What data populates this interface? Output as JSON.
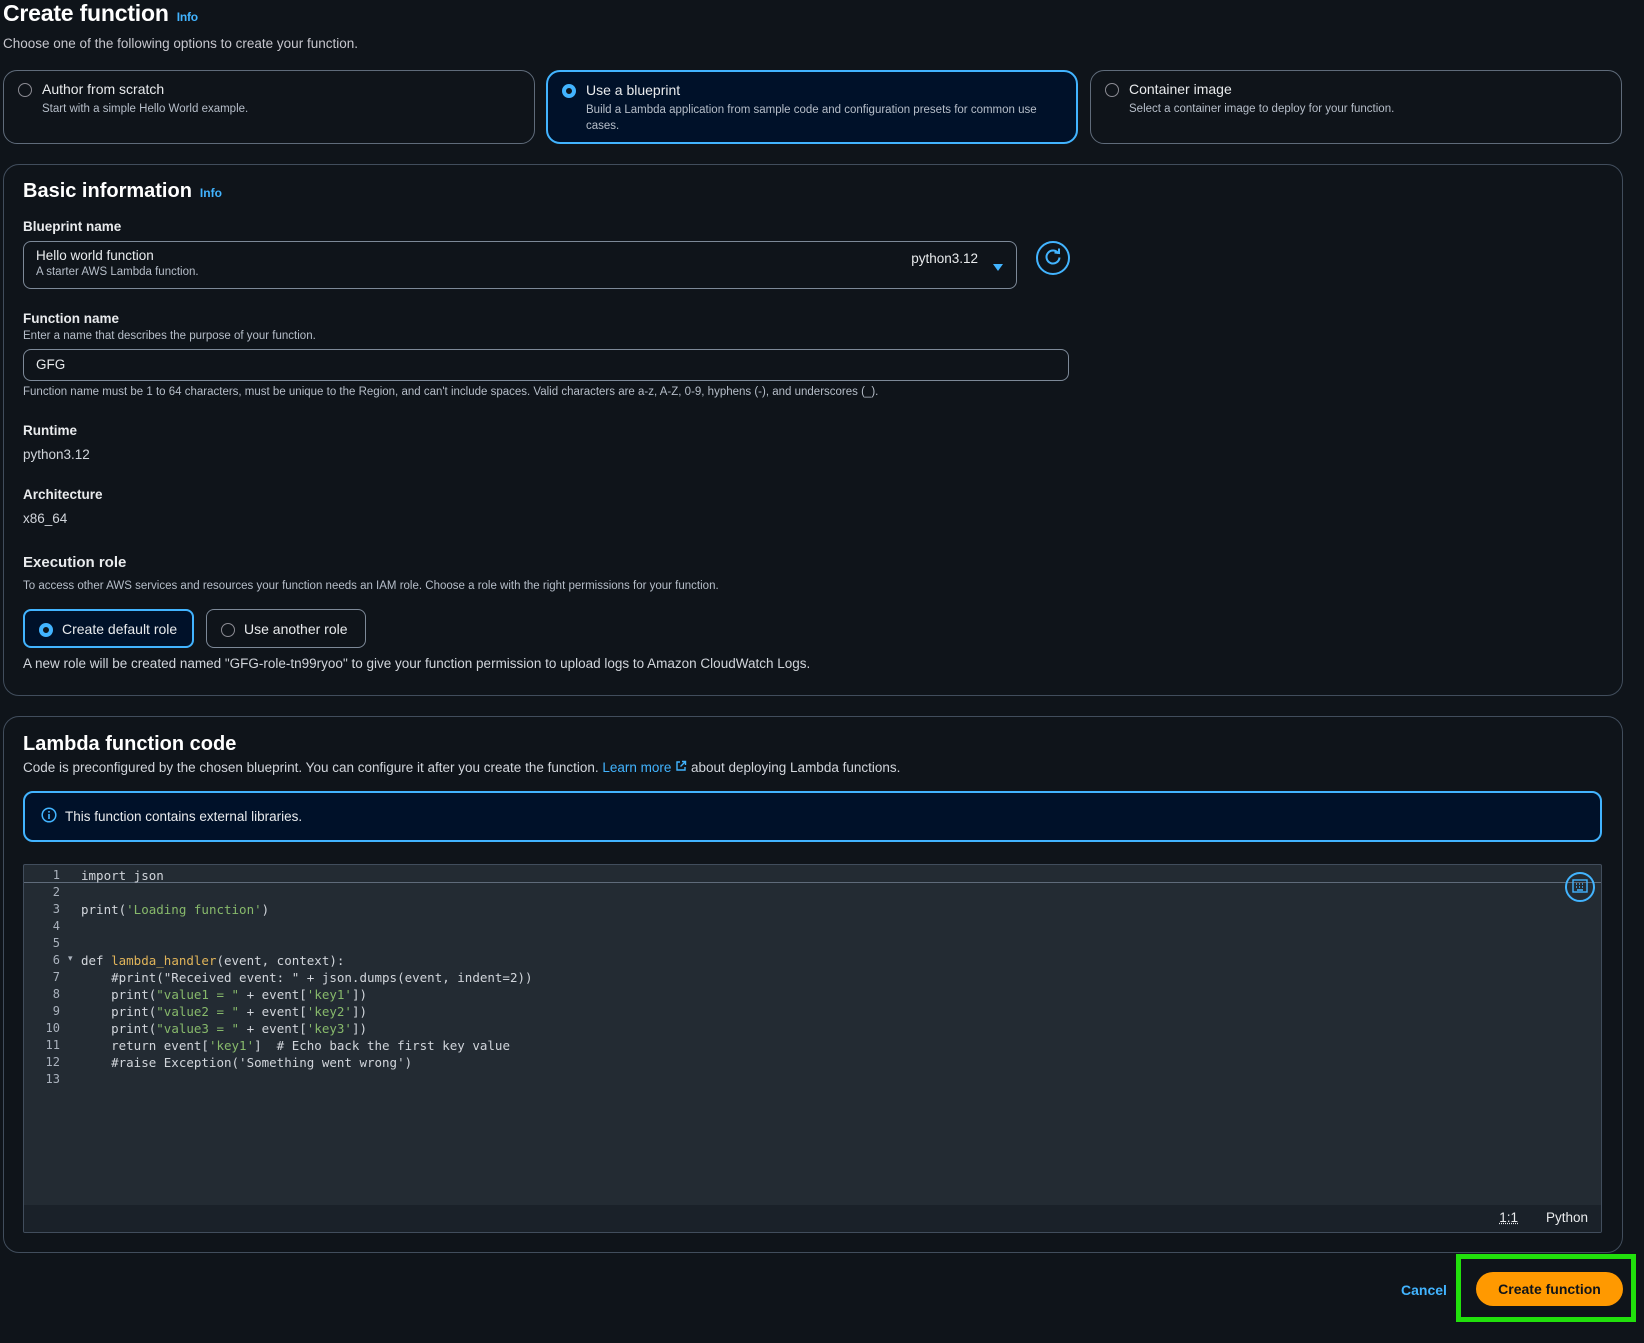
{
  "header": {
    "title": "Create function",
    "info": "Info",
    "subtitle": "Choose one of the following options to create your function."
  },
  "options": [
    {
      "title": "Author from scratch",
      "desc": "Start with a simple Hello World example.",
      "selected": false
    },
    {
      "title": "Use a blueprint",
      "desc": "Build a Lambda application from sample code and configuration presets for common use cases.",
      "selected": true
    },
    {
      "title": "Container image",
      "desc": "Select a container image to deploy for your function.",
      "selected": false
    }
  ],
  "basic": {
    "heading": "Basic information",
    "info": "Info",
    "blueprint_label": "Blueprint name",
    "blueprint_value": "Hello world function",
    "blueprint_desc": "A starter AWS Lambda function.",
    "blueprint_runtime": "python3.12",
    "function_name_label": "Function name",
    "function_name_hint": "Enter a name that describes the purpose of your function.",
    "function_name_value": "GFG",
    "function_name_constraint": "Function name must be 1 to 64 characters, must be unique to the Region, and can't include spaces. Valid characters are a-z, A-Z, 0-9, hyphens (-), and underscores (_).",
    "runtime_label": "Runtime",
    "runtime_value": "python3.12",
    "arch_label": "Architecture",
    "arch_value": "x86_64",
    "role_label": "Execution role",
    "role_hint": "To access other AWS services and resources your function needs an IAM role. Choose a role with the right permissions for your function.",
    "role_default": "Create default role",
    "role_other": "Use another role",
    "role_note": "A new role will be created named \"GFG-role-tn99ryoo\" to give your function permission to upload logs to Amazon CloudWatch Logs."
  },
  "code_section": {
    "heading": "Lambda function code",
    "desc_before": "Code is preconfigured by the chosen blueprint. You can configure it after you create the function.",
    "learn_more": "Learn more",
    "desc_after": "about deploying Lambda functions.",
    "alert": "This function contains external libraries.",
    "cursor": "1:1",
    "language": "Python"
  },
  "code_lines": [
    {
      "n": "1",
      "html": "import json"
    },
    {
      "n": "2",
      "html": ""
    },
    {
      "n": "3",
      "html": "print(<span class='str'>'Loading function'</span>)"
    },
    {
      "n": "4",
      "html": ""
    },
    {
      "n": "5",
      "html": ""
    },
    {
      "n": "6",
      "html": "def <span class='fn'>lambda_handler</span>(event, context):"
    },
    {
      "n": "7",
      "html": "    #print(\"Received event: \" + json.dumps(event, indent=2))"
    },
    {
      "n": "8",
      "html": "    print(<span class='str'>\"value1 = \"</span> + event[<span class='str'>'key1'</span>])"
    },
    {
      "n": "9",
      "html": "    print(<span class='str'>\"value2 = \"</span> + event[<span class='str'>'key2'</span>])"
    },
    {
      "n": "10",
      "html": "    print(<span class='str'>\"value3 = \"</span> + event[<span class='str'>'key3'</span>])"
    },
    {
      "n": "11",
      "html": "    return event[<span class='str'>'key1'</span>]  # Echo back the first key value"
    },
    {
      "n": "12",
      "html": "    #raise Exception('Something went wrong')"
    },
    {
      "n": "13",
      "html": ""
    }
  ],
  "footer": {
    "cancel": "Cancel",
    "create": "Create function"
  },
  "colors": {
    "accent": "#42b4ff",
    "primary": "#ff9900",
    "highlight": "#21e00c",
    "background": "#0f141a"
  }
}
